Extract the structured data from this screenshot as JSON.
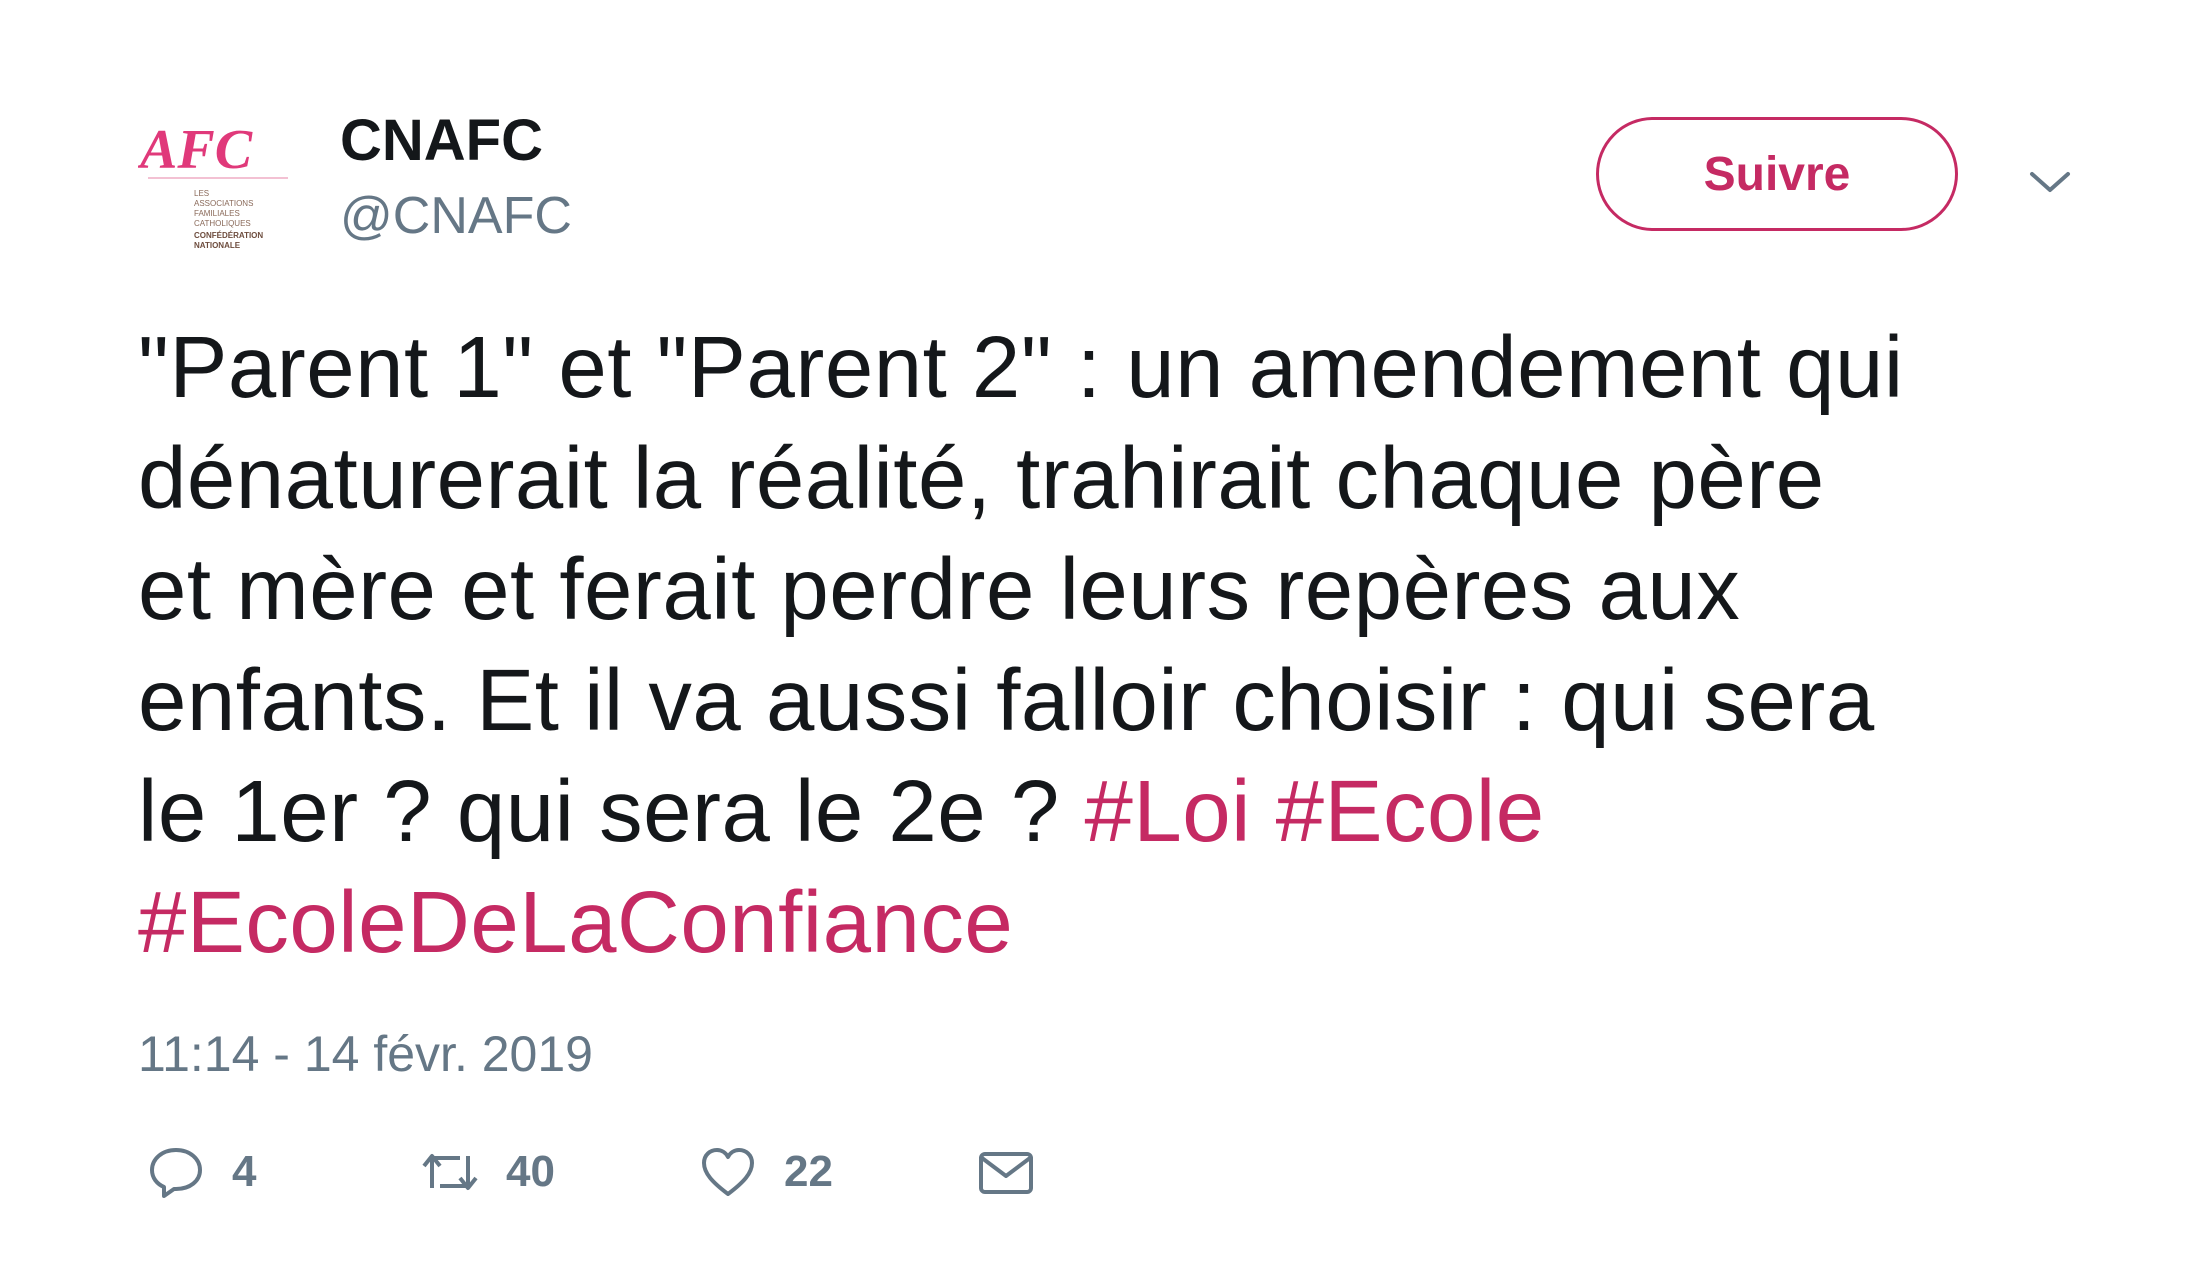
{
  "user": {
    "display_name": "CNAFC",
    "screen_name": "@CNAFC",
    "avatar": {
      "logo_text": "AFC",
      "logo_lines": [
        "LES",
        "ASSOCIATIONS",
        "FAMILIALES",
        "CATHOLIQUES",
        "CONFÉDÉRATION",
        "NATIONALE"
      ],
      "icon": "afc-logo-icon"
    }
  },
  "follow_label": "Suivre",
  "caret_icon": "chevron-down-icon",
  "tweet": {
    "text_lines": [
      "\"Parent 1\" et \"Parent 2\" : un amendement qui",
      "dénaturerait la réalité, trahirait chaque père",
      "et mère et ferait perdre leurs repères aux",
      "enfants. Et il va aussi falloir choisir : qui sera",
      "le 1er ? qui sera le 2e ? "
    ],
    "hashtags": [
      "#Loi",
      "#Ecole",
      "#EcoleDeLaConfiance"
    ],
    "timestamp": "11:14 - 14 févr. 2019"
  },
  "actions": {
    "reply": {
      "icon": "reply-icon",
      "count": "4"
    },
    "retweet": {
      "icon": "retweet-icon",
      "count": "40"
    },
    "like": {
      "icon": "heart-icon",
      "count": "22"
    },
    "dm": {
      "icon": "envelope-icon"
    }
  },
  "colors": {
    "accent": "#c52a63",
    "text": "#14171a",
    "secondary": "#657786"
  }
}
